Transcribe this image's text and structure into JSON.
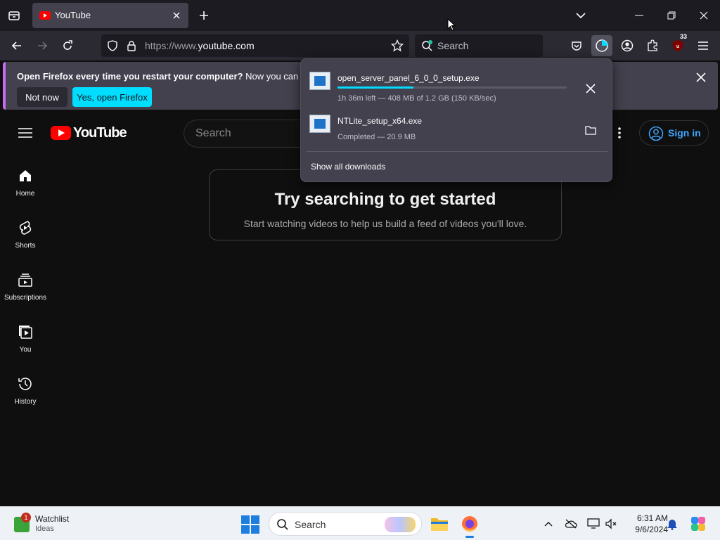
{
  "browser": {
    "tab_title": "YouTube",
    "url_protocol": "https://www.",
    "url_host": "youtube.com",
    "search_placeholder": "Search",
    "extensions_badge": "33"
  },
  "notification": {
    "bold_text": "Open Firefox every time you restart your computer?",
    "text": " Now you can set Fire",
    "not_now_label": "Not now",
    "yes_label": "Yes, open Firefox"
  },
  "downloads": {
    "items": [
      {
        "name": "open_server_panel_6_0_0_setup.exe",
        "status": "1h 36m left — 408 MB of 1.2 GB (150 KB/sec)",
        "progress": 0.33
      },
      {
        "name": "NTLite_setup_x64.exe",
        "status": "Completed — 20.9 MB"
      }
    ],
    "show_all_label": "Show all downloads"
  },
  "youtube": {
    "logo_text": "YouTube",
    "search_placeholder": "Search",
    "sign_in_label": "Sign in",
    "guide": [
      {
        "label": "Home",
        "icon": "home-icon"
      },
      {
        "label": "Shorts",
        "icon": "shorts-icon"
      },
      {
        "label": "Subscriptions",
        "icon": "subscriptions-icon"
      },
      {
        "label": "You",
        "icon": "you-icon"
      },
      {
        "label": "History",
        "icon": "history-icon"
      }
    ],
    "empty_title": "Try searching to get started",
    "empty_subtitle": "Start watching videos to help us build a feed of videos you'll love."
  },
  "taskbar": {
    "widget_title": "Watchlist",
    "widget_subtitle": "Ideas",
    "widget_badge": "1",
    "search_placeholder": "Search",
    "time": "6:31 AM",
    "date": "9/6/2024"
  },
  "colors": {
    "accent": "#00ddff",
    "youtube_red": "#ff0000",
    "signin_blue": "#3ea6ff",
    "notification_border": "#c56cf0"
  }
}
